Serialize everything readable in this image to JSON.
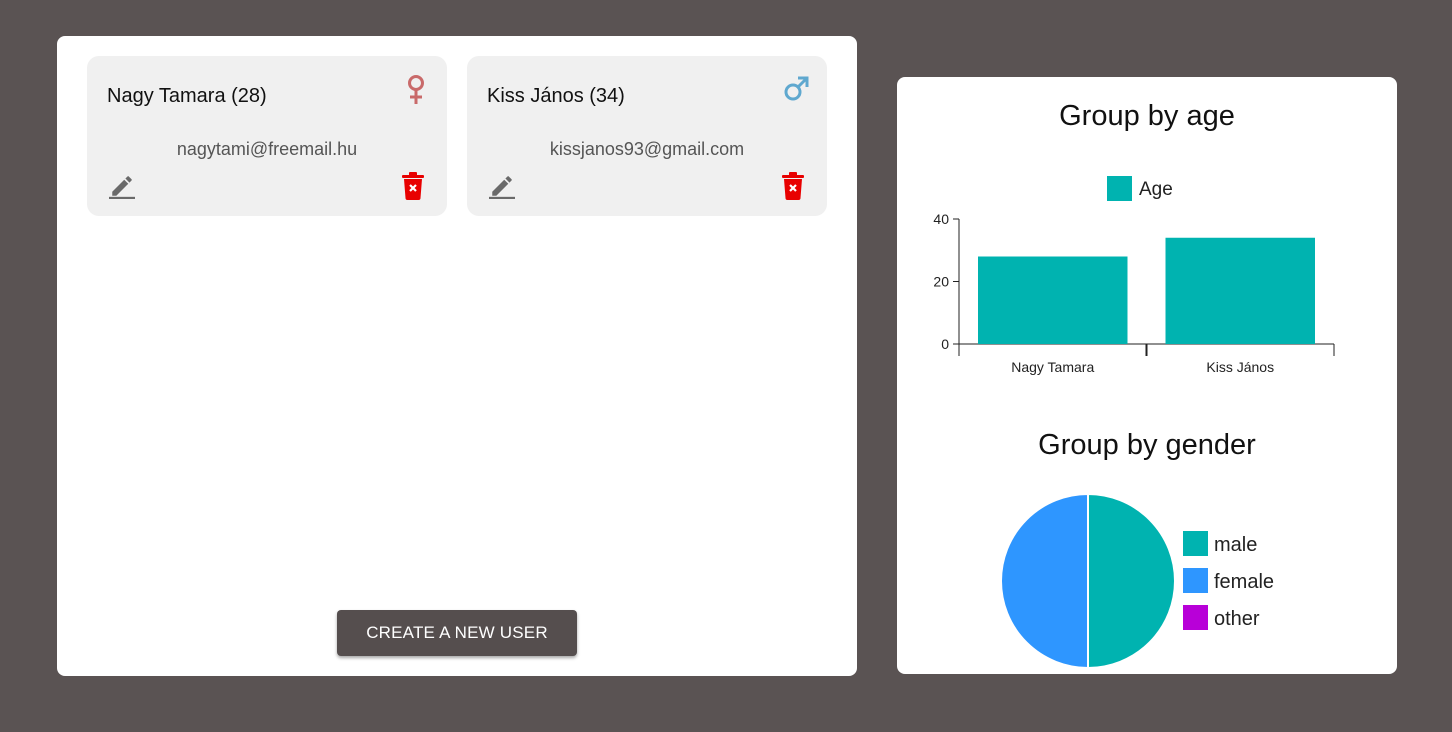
{
  "users": [
    {
      "name": "Nagy Tamara (28)",
      "email": "nagytami@freemail.hu",
      "gender_icon": "female-icon",
      "gender_color": "#c96a6a"
    },
    {
      "name": "Kiss János (34)",
      "email": "kissjanos93@gmail.com",
      "gender_icon": "male-icon",
      "gender_color": "#5fa8cf"
    }
  ],
  "create_button_label": "CREATE A NEW USER",
  "charts": {
    "age_title": "Group by age",
    "gender_title": "Group by gender"
  },
  "colors": {
    "background": "#5a5353",
    "teal": "#00b3b0",
    "blue": "#2e96ff",
    "purple": "#b800d8",
    "delete_red": "#e80000"
  },
  "chart_data": [
    {
      "type": "bar",
      "title": "Group by age",
      "categories": [
        "Nagy Tamara",
        "Kiss János"
      ],
      "series": [
        {
          "name": "Age",
          "values": [
            28,
            34
          ]
        }
      ],
      "yticks": [
        "0",
        "20",
        "40"
      ],
      "ylim": [
        0,
        40
      ],
      "legend": "top"
    },
    {
      "type": "pie",
      "title": "Group by gender",
      "labels": [
        "male",
        "female",
        "other"
      ],
      "values": [
        1,
        1,
        0
      ],
      "colors": [
        "#00b3b0",
        "#2e96ff",
        "#b800d8"
      ],
      "legend": "right"
    }
  ]
}
